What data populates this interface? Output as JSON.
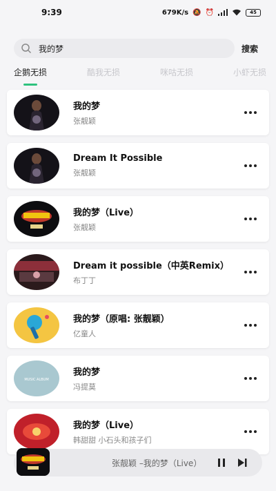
{
  "status": {
    "time": "9:39",
    "net_speed": "679K/s",
    "battery": "45"
  },
  "search": {
    "query": "我的梦",
    "button_label": "搜索"
  },
  "tabs": [
    {
      "label": "企鹅无损",
      "active": true
    },
    {
      "label": "酷我无损",
      "active": false
    },
    {
      "label": "咪咕无损",
      "active": false
    },
    {
      "label": "小虾无损",
      "active": false
    }
  ],
  "songs": [
    {
      "title": "我的梦",
      "artist": "张靓颖",
      "cover": "singer-portrait"
    },
    {
      "title": "Dream It Possible",
      "artist": "张靓颖",
      "cover": "singer-portrait"
    },
    {
      "title": "我的梦（Live）",
      "artist": "张靓颖",
      "cover": "gala-logo"
    },
    {
      "title": "Dream it possible（中英Remix）",
      "artist": "布丁丁",
      "cover": "red-concert"
    },
    {
      "title": "我的梦（原唱: 张靓颖）",
      "artist": "亿童人",
      "cover": "microphone-art"
    },
    {
      "title": "我的梦",
      "artist": "冯提莫",
      "cover": "music-album"
    },
    {
      "title": "我的梦（Live）",
      "artist": "韩甜甜  小石头和孩子们",
      "cover": "red-festival"
    }
  ],
  "music_album_label": "MUSIC ALBUM",
  "player": {
    "now_playing": "张靓颖  –我的梦（Live）"
  },
  "colors": {
    "accent": "#2ec27e"
  }
}
